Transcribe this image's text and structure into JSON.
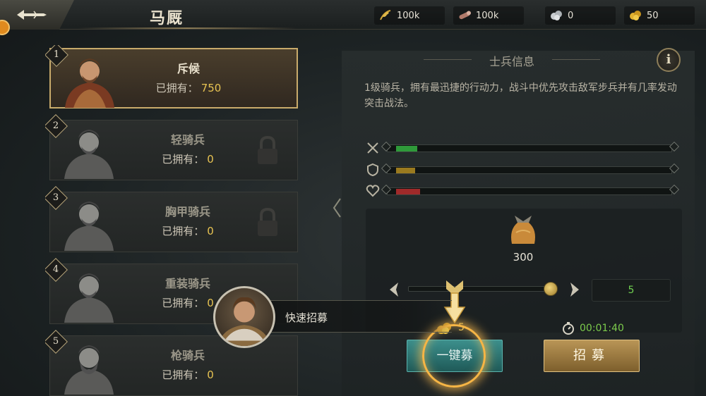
{
  "header": {
    "title": "马厩",
    "resources": [
      {
        "icon": "grain-icon",
        "value": "100k"
      },
      {
        "icon": "wood-log-icon",
        "value": "100k"
      },
      {
        "icon": "silver-coins-icon",
        "value": "0"
      },
      {
        "icon": "gold-coins-icon",
        "value": "50"
      }
    ]
  },
  "units": [
    {
      "number": "1",
      "name": "斥候",
      "owned_label": "已拥有：",
      "owned": "750",
      "selected": true,
      "locked": false
    },
    {
      "number": "2",
      "name": "轻骑兵",
      "owned_label": "已拥有：",
      "owned": "0",
      "selected": false,
      "locked": true
    },
    {
      "number": "3",
      "name": "胸甲骑兵",
      "owned_label": "已拥有：",
      "owned": "0",
      "selected": false,
      "locked": true
    },
    {
      "number": "4",
      "name": "重装骑兵",
      "owned_label": "已拥有：",
      "owned": "0",
      "selected": false,
      "locked": true
    },
    {
      "number": "5",
      "name": "枪骑兵",
      "owned_label": "已拥有：",
      "owned": "0",
      "selected": false,
      "locked": true
    }
  ],
  "info": {
    "title": "士兵信息",
    "info_button": "i",
    "description": "1级骑兵，拥有最迅捷的行动力，战斗中优先攻击敌军步兵并有几率发动突击战法。",
    "stats": [
      {
        "icon": "crossed-swords-icon",
        "level": 0.08,
        "color": "#2f9a3a"
      },
      {
        "icon": "shield-icon",
        "level": 0.07,
        "color": "#9a7a1f"
      },
      {
        "icon": "heart-icon",
        "level": 0.09,
        "color": "#a02a2a"
      }
    ]
  },
  "recruit": {
    "cost": "300",
    "slider_level": 1.0,
    "quantity": "5",
    "timer": "00:01:40",
    "quick_cost": "5",
    "quick_label": "快速招募",
    "quick_button_label": "一键募",
    "recruit_label": "招募"
  },
  "tutorial": {
    "message": "快速招募"
  }
}
